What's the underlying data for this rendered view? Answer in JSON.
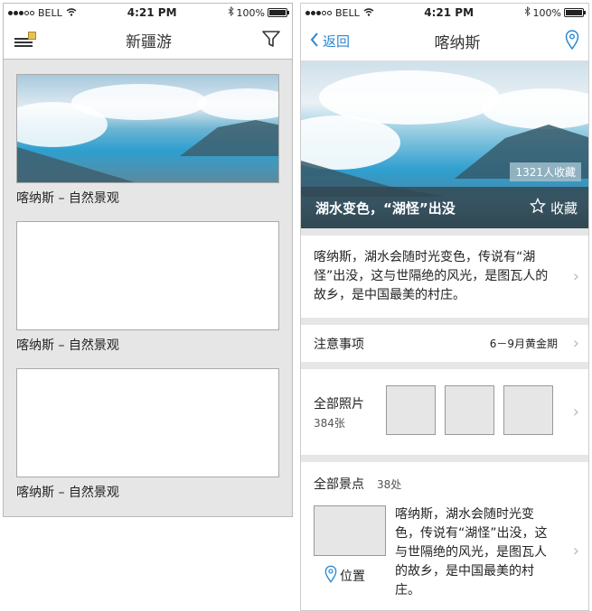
{
  "status": {
    "carrier": "BELL",
    "time": "4:21 PM",
    "battery": "100%"
  },
  "left": {
    "nav_title": "新疆游",
    "cards": [
      {
        "caption": "喀纳斯 – 自然景观",
        "has_image": true
      },
      {
        "caption": "喀纳斯 – 自然景观",
        "has_image": false
      },
      {
        "caption": "喀纳斯 – 自然景观",
        "has_image": false
      }
    ]
  },
  "right": {
    "back_label": "返回",
    "nav_title": "喀纳斯",
    "hero": {
      "fav_count": "1321人收藏",
      "headline": "湖水变色，“湖怪”出没",
      "fav_label": "收藏"
    },
    "description": "喀纳斯，湖水会随时光变色，传说有“湖怪”出没，这与世隔绝的风光，是图瓦人的故乡，是中国最美的村庄。",
    "notice": {
      "label": "注意事项",
      "value": "6－9月黄金期"
    },
    "photos": {
      "label": "全部照片",
      "count": "384张"
    },
    "spots": {
      "label": "全部景点",
      "count": "38处",
      "location_label": "位置",
      "item_text": "喀纳斯，湖水会随时光变色，传说有“湖怪”出没，这与世隔绝的风光，是图瓦人的故乡，是中国最美的村庄。"
    }
  },
  "colors": {
    "accent": "#2a87d0",
    "background_gray": "#e6e6e6"
  }
}
